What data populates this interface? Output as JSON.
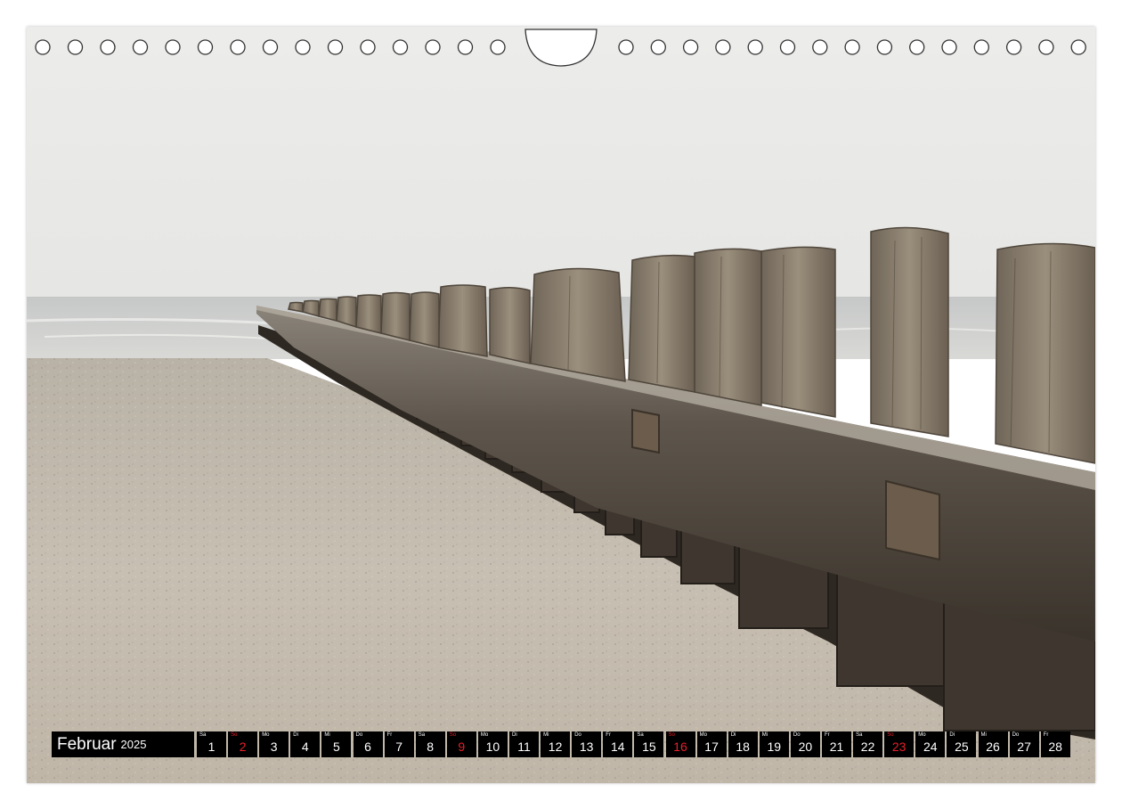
{
  "calendar": {
    "month": "Februar",
    "year": "2025",
    "weekend_color": "#e8202a",
    "days": [
      {
        "abbr": "Sa",
        "num": "1",
        "sunday": false
      },
      {
        "abbr": "So",
        "num": "2",
        "sunday": true
      },
      {
        "abbr": "Mo",
        "num": "3",
        "sunday": false
      },
      {
        "abbr": "Di",
        "num": "4",
        "sunday": false
      },
      {
        "abbr": "Mi",
        "num": "5",
        "sunday": false
      },
      {
        "abbr": "Do",
        "num": "6",
        "sunday": false
      },
      {
        "abbr": "Fr",
        "num": "7",
        "sunday": false
      },
      {
        "abbr": "Sa",
        "num": "8",
        "sunday": false
      },
      {
        "abbr": "So",
        "num": "9",
        "sunday": true
      },
      {
        "abbr": "Mo",
        "num": "10",
        "sunday": false
      },
      {
        "abbr": "Di",
        "num": "11",
        "sunday": false
      },
      {
        "abbr": "Mi",
        "num": "12",
        "sunday": false
      },
      {
        "abbr": "Do",
        "num": "13",
        "sunday": false
      },
      {
        "abbr": "Fr",
        "num": "14",
        "sunday": false
      },
      {
        "abbr": "Sa",
        "num": "15",
        "sunday": false
      },
      {
        "abbr": "So",
        "num": "16",
        "sunday": true
      },
      {
        "abbr": "Mo",
        "num": "17",
        "sunday": false
      },
      {
        "abbr": "Di",
        "num": "18",
        "sunday": false
      },
      {
        "abbr": "Mi",
        "num": "19",
        "sunday": false
      },
      {
        "abbr": "Do",
        "num": "20",
        "sunday": false
      },
      {
        "abbr": "Fr",
        "num": "21",
        "sunday": false
      },
      {
        "abbr": "Sa",
        "num": "22",
        "sunday": false
      },
      {
        "abbr": "So",
        "num": "23",
        "sunday": true
      },
      {
        "abbr": "Mo",
        "num": "24",
        "sunday": false
      },
      {
        "abbr": "Di",
        "num": "25",
        "sunday": false
      },
      {
        "abbr": "Mi",
        "num": "26",
        "sunday": false
      },
      {
        "abbr": "Do",
        "num": "27",
        "sunday": false
      },
      {
        "abbr": "Fr",
        "num": "28",
        "sunday": false
      }
    ]
  }
}
